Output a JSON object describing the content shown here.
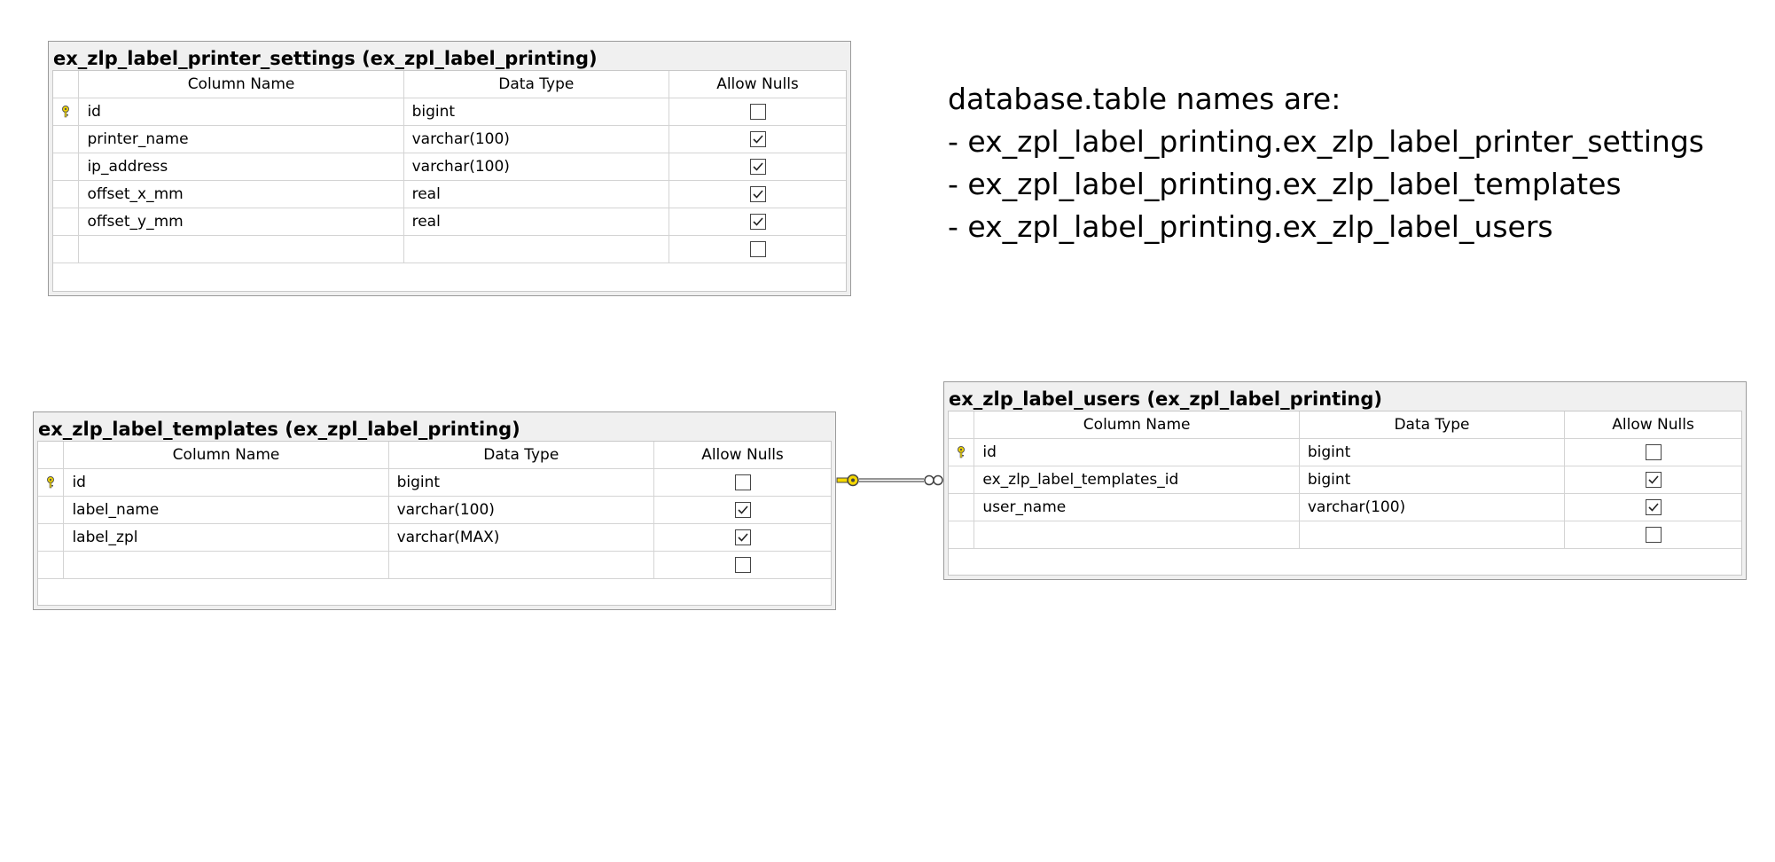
{
  "tables": [
    {
      "id": "printer-settings",
      "title": "ex_zlp_label_printer_settings (ex_zpl_label_printing)",
      "headers": [
        "Column Name",
        "Data Type",
        "Allow Nulls"
      ],
      "rows": [
        {
          "column": "id",
          "type": "bigint",
          "allow_nulls": false,
          "primary_key": true
        },
        {
          "column": "printer_name",
          "type": "varchar(100)",
          "allow_nulls": true,
          "primary_key": false
        },
        {
          "column": "ip_address",
          "type": "varchar(100)",
          "allow_nulls": true,
          "primary_key": false
        },
        {
          "column": "offset_x_mm",
          "type": "real",
          "allow_nulls": true,
          "primary_key": false
        },
        {
          "column": "offset_y_mm",
          "type": "real",
          "allow_nulls": true,
          "primary_key": false
        },
        {
          "column": "",
          "type": "",
          "allow_nulls": false,
          "primary_key": false
        }
      ]
    },
    {
      "id": "templates",
      "title": "ex_zlp_label_templates (ex_zpl_label_printing)",
      "headers": [
        "Column Name",
        "Data Type",
        "Allow Nulls"
      ],
      "rows": [
        {
          "column": "id",
          "type": "bigint",
          "allow_nulls": false,
          "primary_key": true
        },
        {
          "column": "label_name",
          "type": "varchar(100)",
          "allow_nulls": true,
          "primary_key": false
        },
        {
          "column": "label_zpl",
          "type": "varchar(MAX)",
          "allow_nulls": true,
          "primary_key": false
        },
        {
          "column": "",
          "type": "",
          "allow_nulls": false,
          "primary_key": false
        }
      ]
    },
    {
      "id": "users",
      "title": "ex_zlp_label_users (ex_zpl_label_printing)",
      "headers": [
        "Column Name",
        "Data Type",
        "Allow Nulls"
      ],
      "rows": [
        {
          "column": "id",
          "type": "bigint",
          "allow_nulls": false,
          "primary_key": true
        },
        {
          "column": "ex_zlp_label_templates_id",
          "type": "bigint",
          "allow_nulls": true,
          "primary_key": false
        },
        {
          "column": "user_name",
          "type": "varchar(100)",
          "allow_nulls": true,
          "primary_key": false
        },
        {
          "column": "",
          "type": "",
          "allow_nulls": false,
          "primary_key": false
        }
      ]
    }
  ],
  "note": {
    "lines": [
      "database.table names are:",
      "- ex_zpl_label_printing.ex_zlp_label_printer_settings",
      "- ex_zpl_label_printing.ex_zlp_label_templates",
      "- ex_zpl_label_printing.ex_zlp_label_users"
    ]
  },
  "relationship": {
    "from": "ex_zlp_label_templates.id",
    "to": "ex_zlp_label_users.ex_zlp_label_templates_id",
    "from_end": "one-key-icon",
    "to_end": "many-infinity-icon"
  },
  "colors": {
    "key_yellow": "#f5d800",
    "grid_line": "#d4d4d4",
    "panel_bg": "#f0f0f0"
  }
}
